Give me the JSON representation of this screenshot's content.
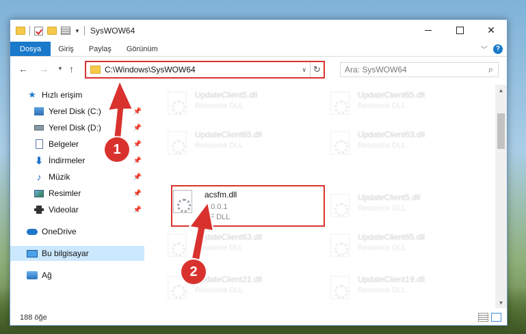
{
  "window": {
    "title": "SysWOW64"
  },
  "ribbon": {
    "tabs": [
      "Dosya",
      "Giriş",
      "Paylaş",
      "Görünüm"
    ],
    "help": "?"
  },
  "address": {
    "path": "C:\\Windows\\SysWOW64",
    "search_placeholder": "Ara: SysWOW64"
  },
  "sidebar": {
    "items": [
      {
        "label": "Hızlı erişim",
        "icon": "star-icon"
      },
      {
        "label": "Yerel Disk (C:)",
        "icon": "drive-c-icon"
      },
      {
        "label": "Yerel Disk (D:)",
        "icon": "drive-d-icon"
      },
      {
        "label": "Belgeler",
        "icon": "documents-icon"
      },
      {
        "label": "İndirmeler",
        "icon": "downloads-icon"
      },
      {
        "label": "Müzik",
        "icon": "music-icon"
      },
      {
        "label": "Resimler",
        "icon": "pictures-icon"
      },
      {
        "label": "Videolar",
        "icon": "videos-icon"
      },
      {
        "label": "OneDrive",
        "icon": "onedrive-icon"
      },
      {
        "label": "Bu bilgisayar",
        "icon": "this-pc-icon"
      },
      {
        "label": "Ağ",
        "icon": "network-icon"
      }
    ]
  },
  "files": [
    {
      "name": "UpdateClient5.dll",
      "line1": "Resource DLL",
      "line2": ""
    },
    {
      "name": "UpdateClient65.dll",
      "line1": "Resource DLL",
      "line2": ""
    },
    {
      "name": "UpdateClient65.dll",
      "line1": "Resource DLL",
      "line2": ""
    },
    {
      "name": "UpdateClient63.dll",
      "line1": "Resource DLL",
      "line2": ""
    },
    {
      "name": "acsfm.dll",
      "line1": "1.0.0.1",
      "line2": "SF DLL"
    },
    {
      "name": "UpdateClient5.dll",
      "line1": "Resource DLL",
      "line2": ""
    },
    {
      "name": "UpdateClient63.dll",
      "line1": "Resource DLL",
      "line2": ""
    },
    {
      "name": "UpdateClient65.dll",
      "line1": "Resource DLL",
      "line2": ""
    },
    {
      "name": "UpdateClient21.dll",
      "line1": "Resource DLL",
      "line2": ""
    },
    {
      "name": "UpdateClient19.dll",
      "line1": "Resource DLL",
      "line2": ""
    }
  ],
  "status": {
    "count": "188 öğe"
  },
  "annotations": {
    "step1": "1",
    "step2": "2",
    "color": "#d9322e"
  }
}
